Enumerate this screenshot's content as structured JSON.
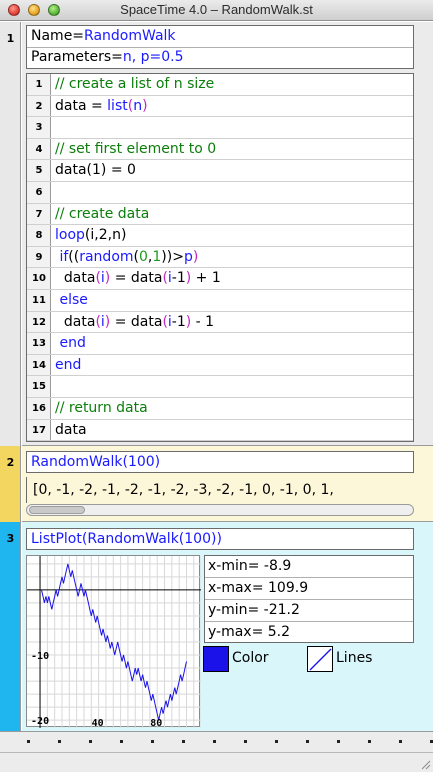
{
  "window": {
    "title": "SpaceTime 4.0 – RandomWalk.st"
  },
  "sections": [
    {
      "number": "1"
    },
    {
      "number": "2"
    },
    {
      "number": "3"
    }
  ],
  "definition": {
    "name_key": "Name=",
    "name_value": "RandomWalk",
    "params_key": "Parameters=",
    "params_value": "n, p=0.5"
  },
  "code_lines": [
    {
      "n": "1",
      "text": "// create a list of n size"
    },
    {
      "n": "2",
      "text": "data = list(n)"
    },
    {
      "n": "3",
      "text": ""
    },
    {
      "n": "4",
      "text": "// set first element to 0"
    },
    {
      "n": "5",
      "text": "data(1) = 0"
    },
    {
      "n": "6",
      "text": ""
    },
    {
      "n": "7",
      "text": "// create data"
    },
    {
      "n": "8",
      "text": "loop(i,2,n)"
    },
    {
      "n": "9",
      "text": " if((random(0,1))>p)"
    },
    {
      "n": "10",
      "text": "  data(i) = data(i-1) + 1"
    },
    {
      "n": "11",
      "text": " else"
    },
    {
      "n": "12",
      "text": "  data(i) = data(i-1) - 1"
    },
    {
      "n": "13",
      "text": " end"
    },
    {
      "n": "14",
      "text": "end"
    },
    {
      "n": "15",
      "text": ""
    },
    {
      "n": "16",
      "text": "// return data"
    },
    {
      "n": "17",
      "text": "data"
    }
  ],
  "call": {
    "expression": "RandomWalk(100)",
    "result": "[0, -1, -2, -1, -2, -1, -2, -3, -2, -1, 0, -1, 0, 1,"
  },
  "plot_call": {
    "expression": "ListPlot(RandomWalk(100))"
  },
  "ranges": {
    "xmin": "x-min= -8.9",
    "xmax": "x-max= 109.9",
    "ymin": "y-min= -21.2",
    "ymax": "y-max= 5.2"
  },
  "controls": {
    "color_label": "Color",
    "lines_label": "Lines"
  },
  "colors": {
    "series": "#1a12e8",
    "section1": "#e8e8e8",
    "section2": "#f3d660",
    "section3": "#1fb5ee"
  },
  "chart_data": {
    "type": "line",
    "title": "",
    "xlabel": "",
    "ylabel": "",
    "xlim": [
      -8.9,
      109.9
    ],
    "ylim": [
      -21.2,
      5.2
    ],
    "x_ticks": [
      "40",
      "80"
    ],
    "y_ticks": [
      "-10",
      "-20"
    ],
    "grid": true,
    "series": [
      {
        "color": "#1a12e8",
        "x": [
          1,
          2,
          3,
          4,
          5,
          6,
          7,
          8,
          9,
          10,
          11,
          12,
          13,
          14,
          15,
          16,
          17,
          18,
          19,
          20,
          21,
          22,
          23,
          24,
          25,
          26,
          27,
          28,
          29,
          30,
          31,
          32,
          33,
          34,
          35,
          36,
          37,
          38,
          39,
          40,
          41,
          42,
          43,
          44,
          45,
          46,
          47,
          48,
          49,
          50,
          51,
          52,
          53,
          54,
          55,
          56,
          57,
          58,
          59,
          60,
          61,
          62,
          63,
          64,
          65,
          66,
          67,
          68,
          69,
          70,
          71,
          72,
          73,
          74,
          75,
          76,
          77,
          78,
          79,
          80,
          81,
          82,
          83,
          84,
          85,
          86,
          87,
          88,
          89,
          90,
          91,
          92,
          93,
          94,
          95,
          96,
          97,
          98,
          99,
          100
        ],
        "y": [
          0,
          -1,
          -2,
          -1,
          -2,
          -1,
          -2,
          -3,
          -2,
          -1,
          0,
          -1,
          0,
          1,
          2,
          1,
          2,
          3,
          4,
          3,
          2,
          3,
          2,
          1,
          0,
          -1,
          0,
          1,
          0,
          -1,
          0,
          -1,
          -2,
          -3,
          -4,
          -3,
          -4,
          -5,
          -4,
          -5,
          -6,
          -7,
          -6,
          -7,
          -8,
          -7,
          -8,
          -9,
          -8,
          -9,
          -10,
          -9,
          -8,
          -9,
          -10,
          -11,
          -10,
          -11,
          -12,
          -11,
          -12,
          -13,
          -14,
          -13,
          -12,
          -13,
          -12,
          -13,
          -14,
          -13,
          -14,
          -15,
          -14,
          -15,
          -16,
          -17,
          -16,
          -17,
          -18,
          -19,
          -20,
          -19,
          -18,
          -19,
          -18,
          -17,
          -18,
          -17,
          -16,
          -17,
          -16,
          -15,
          -16,
          -15,
          -14,
          -13,
          -14,
          -13,
          -12,
          -11
        ]
      }
    ]
  }
}
